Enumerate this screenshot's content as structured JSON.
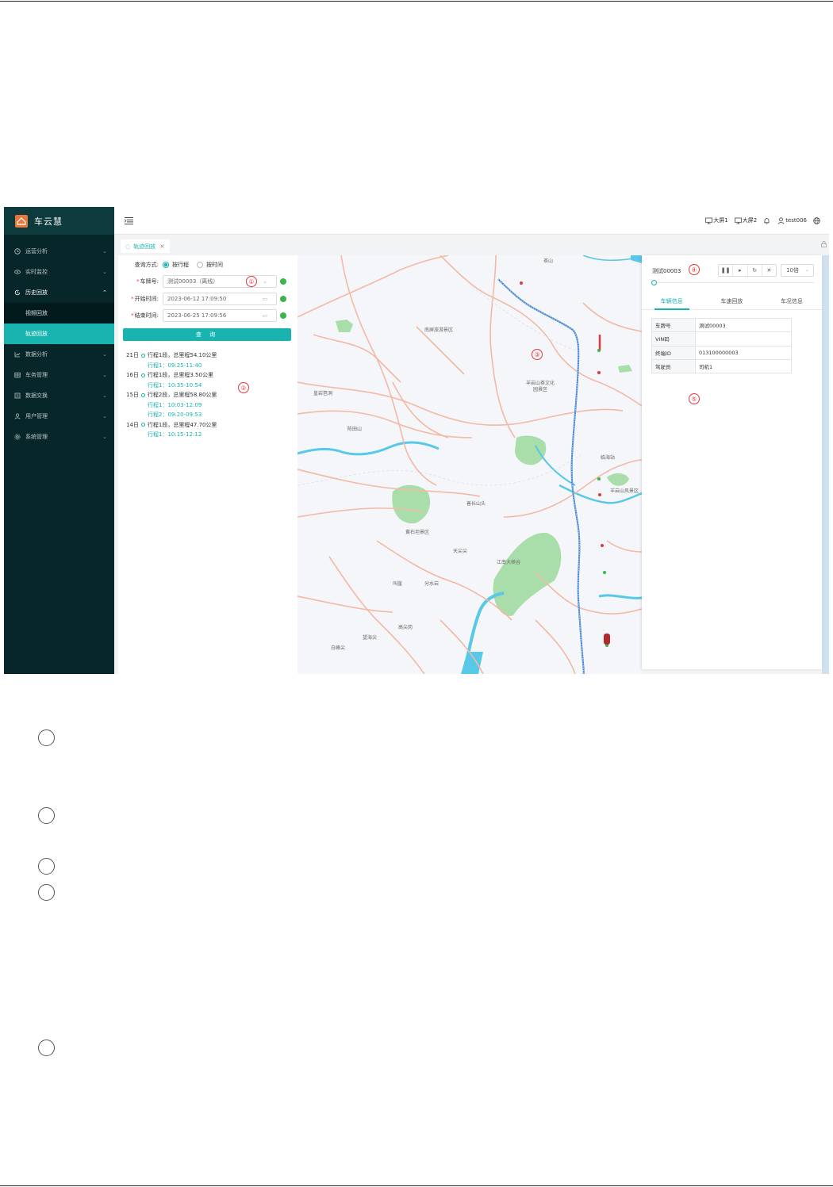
{
  "colors": {
    "accent": "#19b3b0",
    "sidebar": "#06262a",
    "brand_logo": "#e8773b",
    "required": "#e0383e"
  },
  "sidebar": {
    "brand": "车云慧",
    "menu": [
      {
        "label": "运营分析",
        "icon": "clock-icon"
      },
      {
        "label": "实时监控",
        "icon": "eye-icon"
      },
      {
        "label": "历史回放",
        "icon": "history-icon",
        "open": true,
        "children": [
          {
            "label": "视频回放"
          },
          {
            "label": "轨迹回放",
            "active": true
          }
        ]
      },
      {
        "label": "数据分析",
        "icon": "chart-icon"
      },
      {
        "label": "车务管理",
        "icon": "grid-icon"
      },
      {
        "label": "数据交换",
        "icon": "exchange-icon"
      },
      {
        "label": "用户管理",
        "icon": "user-icon"
      },
      {
        "label": "系统管理",
        "icon": "gear-icon"
      }
    ]
  },
  "topbar": {
    "screen1": "大屏1",
    "screen2": "大屏2",
    "username": "test006"
  },
  "tabs": [
    {
      "label": "轨迹回放"
    }
  ],
  "query": {
    "mode_label": "查询方式:",
    "mode_options": [
      "按行程",
      "按时间"
    ],
    "plate_label": "车牌号:",
    "plate_value": "测试00003（离线）",
    "start_label": "开始时间:",
    "start_value": "2023-06-12 17:09:50",
    "end_label": "结束时间:",
    "end_value": "2023-06-25 17:09:56",
    "button": "查 询"
  },
  "trips": [
    {
      "day": "21日",
      "summary": "行程1段，总里程54.10公里",
      "items": [
        "行程1：09:25-11:40"
      ]
    },
    {
      "day": "16日",
      "summary": "行程1段，总里程3.50公里",
      "items": [
        "行程1：10:35-10:54"
      ]
    },
    {
      "day": "15日",
      "summary": "行程2段，总里程58.80公里",
      "items": [
        "行程1：10:03-12:09",
        "行程2：09:20-09:53"
      ]
    },
    {
      "day": "14日",
      "summary": "行程1段，总里程47.70公里",
      "items": [
        "行程1：10:15-12:12"
      ]
    }
  ],
  "map": {
    "labels": [
      "茶山",
      "南屏旅游景区",
      "羊岩山茶文化园景区",
      "皇岩笆洞",
      "陈田山",
      "临海站",
      "羊岩山风景区",
      "善长山头",
      "黄石坦景区",
      "天尖尖",
      "江南大峡谷",
      "叫崖",
      "分水岩",
      "高尖岗",
      "望海尖",
      "白峰尖"
    ]
  },
  "panel": {
    "vehicle": "测试00003",
    "speed": "10倍",
    "tabs": [
      "车辆信息",
      "车速回放",
      "车况信息"
    ],
    "info": [
      {
        "k": "车牌号",
        "v": "测试00003"
      },
      {
        "k": "VIN码",
        "v": ""
      },
      {
        "k": "终端ID",
        "v": "013100000003"
      },
      {
        "k": "驾驶员",
        "v": "司机1"
      }
    ]
  },
  "markers": [
    "①",
    "②",
    "③",
    "④",
    "⑤"
  ]
}
